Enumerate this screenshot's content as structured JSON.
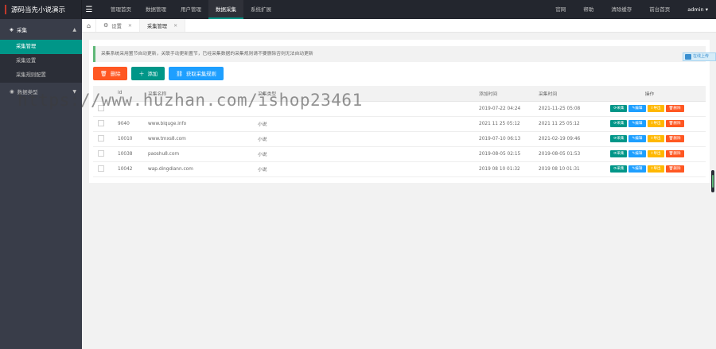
{
  "app": {
    "title": "源码当先小说演示"
  },
  "topnav": [
    "管理首页",
    "数据管理",
    "用户管理",
    "数据采集",
    "系统扩展"
  ],
  "rightnav": [
    "官网",
    "帮助",
    "清除缓存",
    "前台首页",
    "admin"
  ],
  "sidebar": {
    "group1": "采集",
    "items": [
      "采集管理",
      "采集设置",
      "采集规则配置"
    ],
    "group2": "数据类型"
  },
  "tabs": {
    "settings": "设置",
    "collect": "采集管理"
  },
  "notice": "采集系统采用置节自动更新，关联手动更新置节，已经采集数据的采集规则请不要删除否则无法自动更新",
  "actions": {
    "delete": "删除",
    "add": "添加",
    "fetch": "获取采集规则"
  },
  "columns": {
    "id": "id",
    "name": "采集名称",
    "type": "采集类型",
    "added": "添加时间",
    "collected": "采集时间",
    "ops": "操作"
  },
  "row_ops": {
    "collect": "采集",
    "edit": "编辑",
    "export": "导出",
    "delete": "删除"
  },
  "rows": [
    {
      "id": "",
      "name": "",
      "type": "",
      "added": "2019-07-22 04:24",
      "collected": "2021-11-25 05:08"
    },
    {
      "id": "9040",
      "name": "www.biquge.info",
      "type": "小说",
      "added": "2021 11 25 05:12",
      "collected": "2021 11 25 05:12"
    },
    {
      "id": "10010",
      "name": "www.tmxs8.com",
      "type": "小说",
      "added": "2019-07-10 06:13",
      "collected": "2021-02-19 09:46"
    },
    {
      "id": "10038",
      "name": "paoshu8.com",
      "type": "小说",
      "added": "2019-08-05 02:15",
      "collected": "2019-08-05 01:53"
    },
    {
      "id": "10042",
      "name": "wap.dingdiann.com",
      "type": "小说",
      "added": "2019 08 10 01:32",
      "collected": "2019 08 10 01:31"
    }
  ],
  "float_badge": "在线上传",
  "watermark": "https://www.huzhan.com/ishop23461",
  "colors": {
    "sidebar": "#393d49",
    "topbar": "#23262e",
    "accent": "#009688",
    "danger": "#ff5722",
    "info": "#1e9fff",
    "warn": "#ffb800"
  }
}
